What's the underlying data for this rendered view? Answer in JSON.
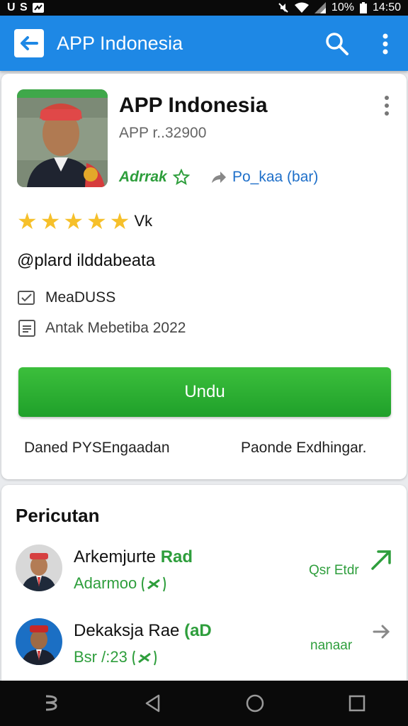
{
  "status_bar": {
    "left_text": "U S",
    "battery": "10%",
    "time": "14:50"
  },
  "app_bar": {
    "title": "APP Indonesia",
    "icons": [
      "back-arrow-icon",
      "search-icon",
      "more-vert-icon"
    ]
  },
  "app_card": {
    "name": "APP Indonesia",
    "sub": "APP r..32900",
    "tag_green": "Adrrak",
    "tag_blue": "Po_kaa (bar)",
    "rating_stars": 5,
    "rating_label": "Vk",
    "handle": "@plard ilddabeata",
    "meta1": "MeaDUSS",
    "meta2": "Antak Mebetiba 2022",
    "install_label": "Undu",
    "footer_left": "Daned PYSEngaadan",
    "footer_right": "Paonde Exdhingar.",
    "colors": {
      "install": "#2db134",
      "accent_green": "#2e9e3c",
      "accent_blue": "#1e6fc9",
      "star": "#f6c02a"
    }
  },
  "developers": {
    "title": "Pericutan",
    "items": [
      {
        "name": "Arkemjurte",
        "badge": "Rad",
        "sub": "Adarmoo",
        "right": "Qsr Etdr"
      },
      {
        "name": "Dekaksja Rae",
        "badge": "(aD",
        "sub": "Bsr /:23",
        "right": "nanaar"
      }
    ]
  },
  "colors": {
    "app_bar": "#1e88e5",
    "background": "#e9ebee"
  }
}
